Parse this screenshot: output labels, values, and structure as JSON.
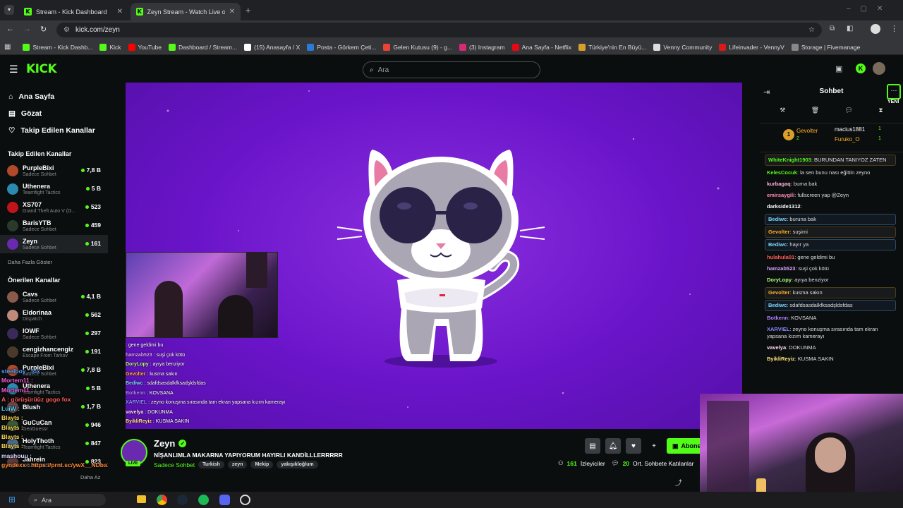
{
  "browser": {
    "tabs": [
      {
        "title": "Stream - Kick Dashboard",
        "active": false
      },
      {
        "title": "Zeyn Stream - Watch Live on Ki",
        "active": true
      }
    ],
    "url": "kick.com/zeyn",
    "bookmarks": [
      "Stream - Kick Dashb...",
      "Kick",
      "YouTube",
      "Dashboard / Stream...",
      "(15) Anasayfa / X",
      "Posta - Görkem Çeti...",
      "Gelen Kutusu (9) - g...",
      "(3) Instagram",
      "Ana Sayfa - Netflix",
      "Türkiye'nin En Büyü...",
      "Venny Community",
      "Lifeinvader - VennyV",
      "Storage | Fivemanage"
    ]
  },
  "header": {
    "search_placeholder": "Ara"
  },
  "sidebar": {
    "nav": [
      "Ana Sayfa",
      "Gözat",
      "Takip Edilen Kanallar"
    ],
    "followed_title": "Takip Edilen Kanallar",
    "followed": [
      {
        "name": "PurpleBixi",
        "category": "Sadece Sohbet",
        "viewers": "7,8 B",
        "color": "#b04a2a"
      },
      {
        "name": "Uthenera",
        "category": "Teamfight Tactics",
        "viewers": "5 B",
        "color": "#2a8ab0"
      },
      {
        "name": "XS707",
        "category": "Grand Theft Auto V (G...",
        "viewers": "523",
        "color": "#c0141a"
      },
      {
        "name": "BarisYTB",
        "category": "Sadece Sohbet",
        "viewers": "459",
        "color": "#2a3a2a"
      },
      {
        "name": "Zeyn",
        "category": "Sadece Sohbet",
        "viewers": "161",
        "color": "#6a2ab0"
      }
    ],
    "show_more": "Daha Fazla Göster",
    "recommended_title": "Önerilen Kanallar",
    "recommended": [
      {
        "name": "Cavs",
        "category": "Sadece Sohbet",
        "viewers": "4,1 B",
        "color": "#8a5a4a"
      },
      {
        "name": "Eldorinaa",
        "category": "Dispatch",
        "viewers": "562",
        "color": "#c08a7a"
      },
      {
        "name": "IOWF",
        "category": "Sadece Sohbet",
        "viewers": "297",
        "color": "#3a2a5a"
      },
      {
        "name": "cengizhancengiz",
        "category": "Escape From Tarkov",
        "viewers": "191",
        "color": "#4a3a2a"
      },
      {
        "name": "PurpleBixi",
        "category": "Sadece Sohbet",
        "viewers": "7,8 B",
        "color": "#b04a2a"
      },
      {
        "name": "Uthenera",
        "category": "Teamfight Tactics",
        "viewers": "5 B",
        "color": "#2a8ab0"
      },
      {
        "name": "Blush",
        "category": "",
        "viewers": "1,7 B",
        "color": "#6a4a4a"
      },
      {
        "name": "GuCuCan",
        "category": "GeoGuessr",
        "viewers": "946",
        "color": "#3a5a3a"
      },
      {
        "name": "HolyThoth",
        "category": "Teamfight Tactics",
        "viewers": "847",
        "color": "#4a6a8a"
      },
      {
        "name": "Jahrein",
        "category": "VALORANT",
        "viewers": "823",
        "color": "#5a3a3a"
      }
    ],
    "show_less": "Daha Az"
  },
  "overlay_left": [
    {
      "text": "steelboy : fox",
      "color": "#5aa0ff"
    },
    {
      "text": "Mortem11 :",
      "color": "#ff5ad8"
    },
    {
      "text": "Mortem11 :",
      "color": "#ff5ad8"
    },
    {
      "text": "A      : görüşürüüz gogo fox",
      "color": "#ff5a5a"
    },
    {
      "text": "LuiW :",
      "color": "#5ad8ff"
    },
    {
      "text": "Blayts :",
      "color": "#ffd85a"
    },
    {
      "text": "Blayts :",
      "color": "#ffd85a"
    },
    {
      "text": "Blayts :",
      "color": "#ffd85a"
    },
    {
      "text": "Blayts :",
      "color": "#ffd85a"
    },
    {
      "text": "mashouu :",
      "color": "#d8d8ff"
    },
    {
      "text": "gyndexx : https://prnt.sc/ywX__NDba1ge",
      "color": "#ff8a3a"
    }
  ],
  "overlay_chat": [
    {
      "user": "",
      "text": ": gene geldimi bu",
      "color": "#ff5a5a"
    },
    {
      "user": "hamzab523",
      "text": ": suşi çok kötü",
      "color": "#d8a0ff"
    },
    {
      "user": "DoryLopy",
      "text": ": ayıya benziyor",
      "color": "#b0ff7a"
    },
    {
      "user": "Gevolter",
      "text": ": kusma sakın",
      "color": "#ffb02a"
    },
    {
      "user": "Bediwc",
      "text": ": sdafdsasdalkfksadşldsfdas",
      "color": "#7ad8ff"
    },
    {
      "user": "Botkenn",
      "text": ": KOVSANA",
      "color": "#b080ff"
    },
    {
      "user": "XARVIEL",
      "text": ": zeyno konuşma sırasında tam ekran yapsana kızım kamerayı",
      "color": "#8a8aff"
    },
    {
      "user": "vavelya",
      "text": ": DOKUNMA",
      "color": "#ffd8f0"
    },
    {
      "user": "ByikliReyiz",
      "text": ": KUSMA SAKIN",
      "color": "#ffe07a"
    }
  ],
  "stream": {
    "streamer": "Zeyn",
    "title": "NİŞANLIMLA MAKARNA YAPIYORUM HAYIRLI KANDİLLLERRRRR",
    "category": "Sadece Sohbet",
    "tags": [
      "Turkish",
      "zeyn",
      "Mekip",
      "yakışıkloğlum"
    ],
    "live_badge": "LIVE",
    "viewers": "161",
    "viewers_label": "İzleyiciler",
    "chatters": "20",
    "chatters_label": "Ort. Sohbete Katılanlar",
    "subscribe": "Abone"
  },
  "chat": {
    "title": "Sohbet",
    "new_badge": "YENİ",
    "top_gifters": [
      {
        "name": "Gevolter",
        "count": "2"
      },
      {
        "name": "macius1881",
        "count": "1"
      },
      {
        "name": "Furuko_O",
        "count": "1"
      }
    ],
    "messages": [
      {
        "user": "WhiteKnight1903",
        "text": ": BURUNDAN TANIYOZ ZATEN",
        "color": "#53fc18",
        "style": "hl"
      },
      {
        "user": "KelesCocuk",
        "text": ": la sen bunu nası eğittin zeyno",
        "color": "#53fc18",
        "style": ""
      },
      {
        "user": "kurbagaq",
        "text": ": burna bak",
        "color": "#ffb0d8",
        "style": ""
      },
      {
        "user": "emirsaygili",
        "text": ": fullscreen yap @Zeyn",
        "color": "#ff8ab0",
        "style": ""
      },
      {
        "user": "darkside1312",
        "text": ":",
        "color": "#fff",
        "style": ""
      },
      {
        "user": "Bediwc",
        "text": ": buruna bak",
        "color": "#7ad8ff",
        "style": "hl2"
      },
      {
        "user": "Gevolter",
        "text": ": suşimi",
        "color": "#ffb02a",
        "style": "hl"
      },
      {
        "user": "Bediwc",
        "text": ": hayır ya",
        "color": "#7ad8ff",
        "style": "hl2"
      },
      {
        "user": "hulahula01",
        "text": ": gene geldimi bu",
        "color": "#ff5a5a",
        "style": ""
      },
      {
        "user": "hamzab523",
        "text": ": suşi çok kötü",
        "color": "#d8a0ff",
        "style": ""
      },
      {
        "user": "DoryLopy",
        "text": ": ayıya benziyor",
        "color": "#b0ff7a",
        "style": ""
      },
      {
        "user": "Gevolter",
        "text": ": kusma sakın",
        "color": "#ffb02a",
        "style": "hl"
      },
      {
        "user": "Bediwc",
        "text": ": sdafdsasdalkfksadşldsfdas",
        "color": "#7ad8ff",
        "style": "hl2"
      },
      {
        "user": "Botkenn",
        "text": ": KOVSANA",
        "color": "#b080ff",
        "style": ""
      },
      {
        "user": "XARVIEL",
        "text": ": zeyno konuşma sırasında tam ekran yapsana kızım kamerayı",
        "color": "#8a8aff",
        "style": ""
      },
      {
        "user": "vavelya",
        "text": ": DOKUNMA",
        "color": "#ffd8f0",
        "style": ""
      },
      {
        "user": "ByikliReyiz",
        "text": ": KUSMA SAKIN",
        "color": "#ffe07a",
        "style": ""
      }
    ]
  },
  "taskbar": {
    "search_placeholder": "Ara"
  }
}
